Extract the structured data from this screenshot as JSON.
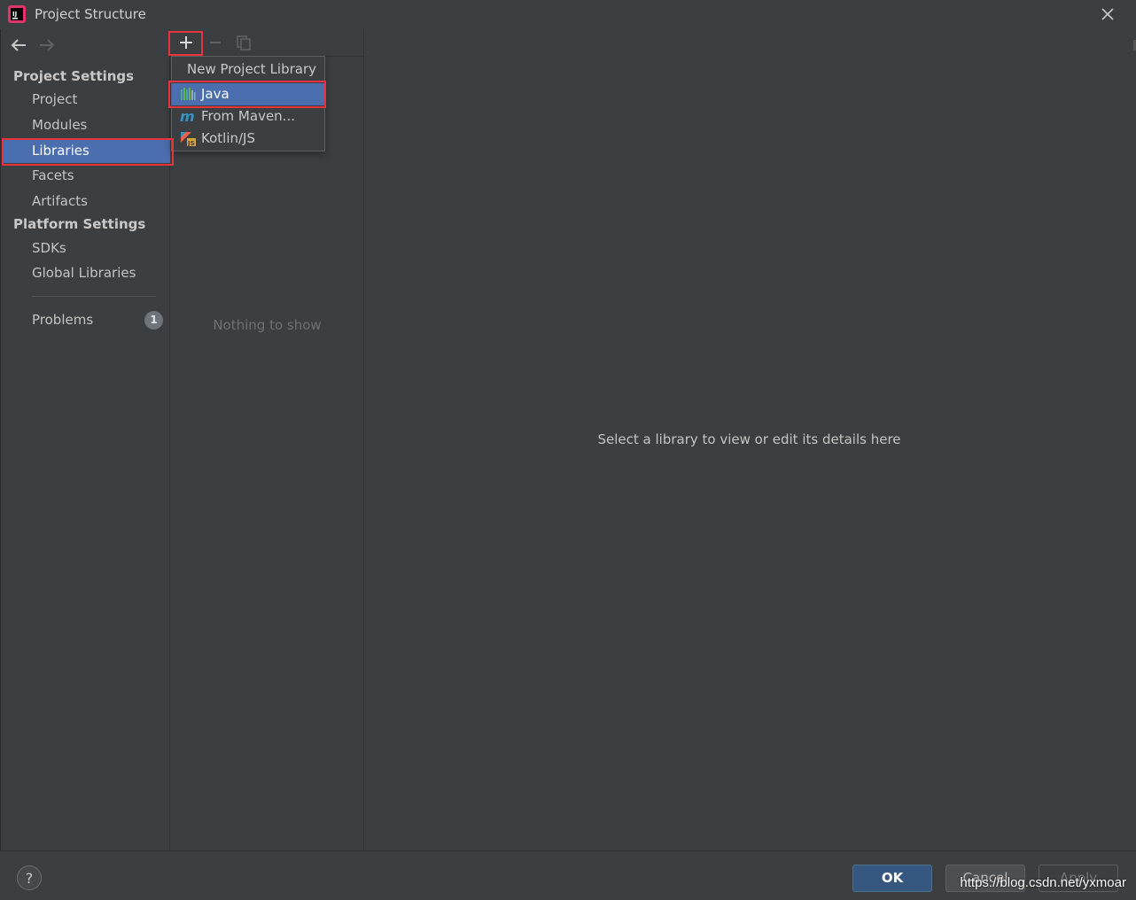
{
  "window": {
    "title": "Project Structure"
  },
  "sidebar": {
    "project_settings_header": "Project Settings",
    "project_items": [
      {
        "label": "Project"
      },
      {
        "label": "Modules"
      },
      {
        "label": "Libraries"
      },
      {
        "label": "Facets"
      },
      {
        "label": "Artifacts"
      }
    ],
    "platform_settings_header": "Platform Settings",
    "platform_items": [
      {
        "label": "SDKs"
      },
      {
        "label": "Global Libraries"
      }
    ],
    "problems_label": "Problems",
    "problems_count": "1"
  },
  "list_pane": {
    "empty_text": "Nothing to show"
  },
  "popup": {
    "title": "New Project Library",
    "items": [
      {
        "label": "Java",
        "icon": "java-library-icon"
      },
      {
        "label": "From Maven...",
        "icon": "maven-icon"
      },
      {
        "label": "Kotlin/JS",
        "icon": "kotlin-js-icon"
      }
    ]
  },
  "details_pane": {
    "placeholder": "Select a library to view or edit its details here"
  },
  "footer": {
    "help_label": "?",
    "ok_label": "OK",
    "cancel_label": "Cancel",
    "apply_label": "Apply"
  },
  "watermark": "https://blog.csdn.net/yxmoar",
  "colors": {
    "background": "#3c3f41",
    "selection": "#4b6eaf",
    "highlight_box": "#e8323c",
    "ok_button": "#365880"
  }
}
